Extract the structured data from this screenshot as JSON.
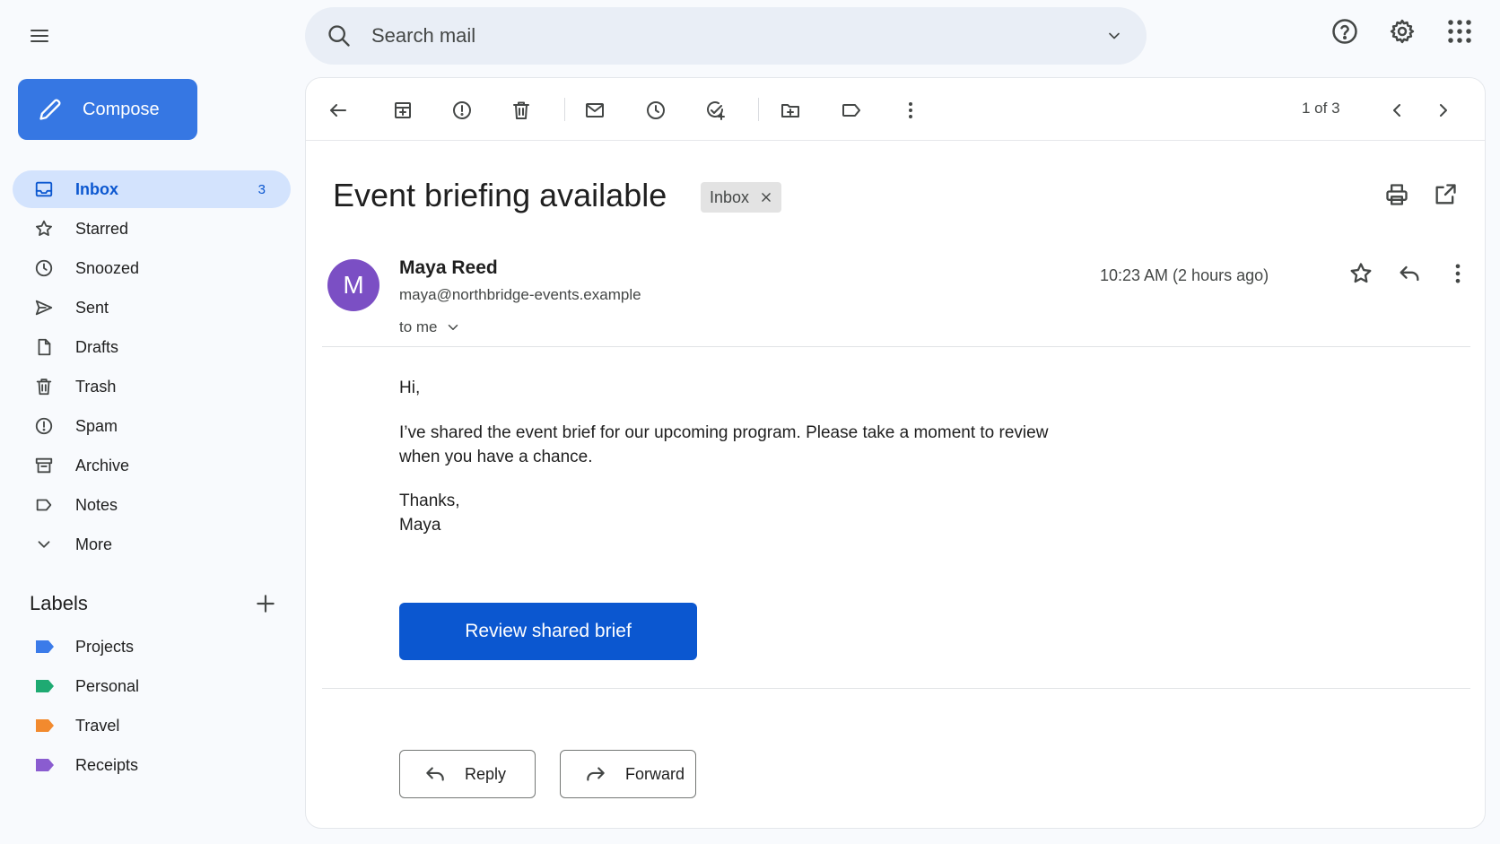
{
  "search": {
    "placeholder": "Search mail"
  },
  "compose": {
    "label": "Compose"
  },
  "sidebar": {
    "items": [
      {
        "label": "Inbox",
        "count": "3",
        "icon": "inbox-icon"
      },
      {
        "label": "Starred",
        "icon": "star-icon"
      },
      {
        "label": "Snoozed",
        "icon": "clock-icon"
      },
      {
        "label": "Sent",
        "icon": "send-icon"
      },
      {
        "label": "Drafts",
        "icon": "draft-icon"
      },
      {
        "label": "Trash",
        "icon": "trash-icon"
      },
      {
        "label": "Spam",
        "icon": "spam-icon"
      },
      {
        "label": "Archive",
        "icon": "archive-icon"
      },
      {
        "label": "Notes",
        "icon": "label-outline-icon"
      },
      {
        "label": "More",
        "icon": "chevron-down-icon"
      }
    ]
  },
  "labels": {
    "title": "Labels",
    "items": [
      {
        "label": "Projects",
        "color": "#3b7be9"
      },
      {
        "label": "Personal",
        "color": "#1eaa72"
      },
      {
        "label": "Travel",
        "color": "#f28a2e"
      },
      {
        "label": "Receipts",
        "color": "#8a5cd0"
      }
    ]
  },
  "toolbar": {
    "pager": "1 of 3"
  },
  "email": {
    "subject": "Event briefing available",
    "chip": "Inbox",
    "sender_initial": "M",
    "sender_name": "Maya Reed",
    "sender_email": "maya@northbridge-events.example",
    "to": "to me",
    "time": "10:23 AM (2 hours ago)",
    "greeting": "Hi,",
    "paragraph_line1": "I’ve shared the event brief for our upcoming program. Please take a moment to review",
    "paragraph_line2": "when you have a chance.",
    "signoff": "Thanks,",
    "signature": "Maya",
    "cta": "Review shared brief"
  },
  "actions": {
    "reply": "Reply",
    "forward": "Forward"
  },
  "colors": {
    "accent": "#0b57d0",
    "compose": "#3677e3",
    "avatar": "#7b4fc4",
    "active_nav": "#d3e3fd"
  }
}
